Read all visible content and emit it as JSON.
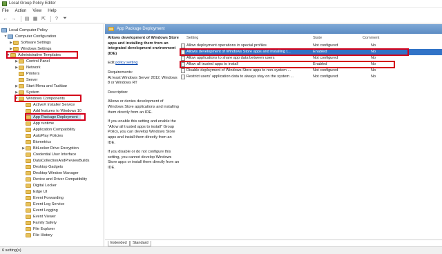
{
  "window": {
    "title": "Local Group Policy Editor"
  },
  "menu": [
    "File",
    "Action",
    "View",
    "Help"
  ],
  "toolbar": {
    "icons": [
      "back-arrow-icon",
      "forward-arrow-icon",
      "show-hide-tree-icon",
      "properties-icon",
      "export-list-icon",
      "help-icon",
      "filter-icon"
    ],
    "glyphs": [
      "←",
      "→",
      "▤",
      "▦",
      "⇱",
      "?",
      "⏷"
    ]
  },
  "tree": {
    "root": "Local Computer Policy",
    "computer_config": "Computer Configuration",
    "software_settings": "Software Settings",
    "windows_settings": "Windows Settings",
    "admin_templates": "Administrative Templates",
    "control_panel": "Control Panel",
    "network": "Network",
    "printers": "Printers",
    "server": "Server",
    "start_menu": "Start Menu and Taskbar",
    "system": "System",
    "windows_components": "Windows Components",
    "components": [
      "ActiveX Installer Service",
      "Add features to Windows 10",
      "App Package Deployment",
      "App runtime",
      "Application Compatibility",
      "AutoPlay Policies",
      "Biometrics",
      "BitLocker Drive Encryption",
      "Credential User Interface",
      "DataCollectionAndPreviewBuilds",
      "Desktop Gadgets",
      "Desktop Window Manager",
      "Device and Driver Compatibility",
      "Digital Locker",
      "Edge UI",
      "Event Forwarding",
      "Event Log Service",
      "Event Logging",
      "Event Viewer",
      "Family Safety",
      "File Explorer",
      "File History"
    ]
  },
  "right": {
    "header": "App Package Deployment",
    "desc": {
      "title": "Allows development of Windows Store apps and installing them from an integrated development environment (IDE)",
      "edit_prefix": "Edit ",
      "edit_link": "policy setting",
      "requirements_label": "Requirements:",
      "requirements": "At least Windows Server 2012, Windows 8 or Windows RT",
      "description_label": "Description:",
      "p1": "Allows or denies development of Windows Store applications and installing them directly from an IDE.",
      "p2": "If you enable this setting and enable the \"Allow all trusted apps to install\" Group Policy, you can develop Windows Store apps and install them directly from an IDE.",
      "p3": "If you disable or do not configure this setting, you cannot develop Windows Store apps or install them directly from an IDE."
    },
    "columns": {
      "setting": "Setting",
      "state": "State",
      "comment": "Comment"
    },
    "rows": [
      {
        "setting": "Allow deployment operations in special profiles",
        "state": "Not configured",
        "comment": "No"
      },
      {
        "setting": "Allows development of Windows Store apps and installing t...",
        "state": "Enabled",
        "comment": "No"
      },
      {
        "setting": "Allow applications to share app data between users",
        "state": "Not configured",
        "comment": "No"
      },
      {
        "setting": "Allow all trusted apps to install",
        "state": "Enabled",
        "comment": "No"
      },
      {
        "setting": "Disable deployment of Windows Store apps to non-system ...",
        "state": "Not configured",
        "comment": "No"
      },
      {
        "setting": "Restrict users' application data to always stay on the system ...",
        "state": "Not configured",
        "comment": "No"
      }
    ],
    "tabs": [
      "Extended",
      "Standard"
    ]
  },
  "status": {
    "text": "6 setting(s)"
  },
  "colors": {
    "highlight": "#d4001a",
    "selection": "#3173c7",
    "header_band": "#6a97cc"
  }
}
